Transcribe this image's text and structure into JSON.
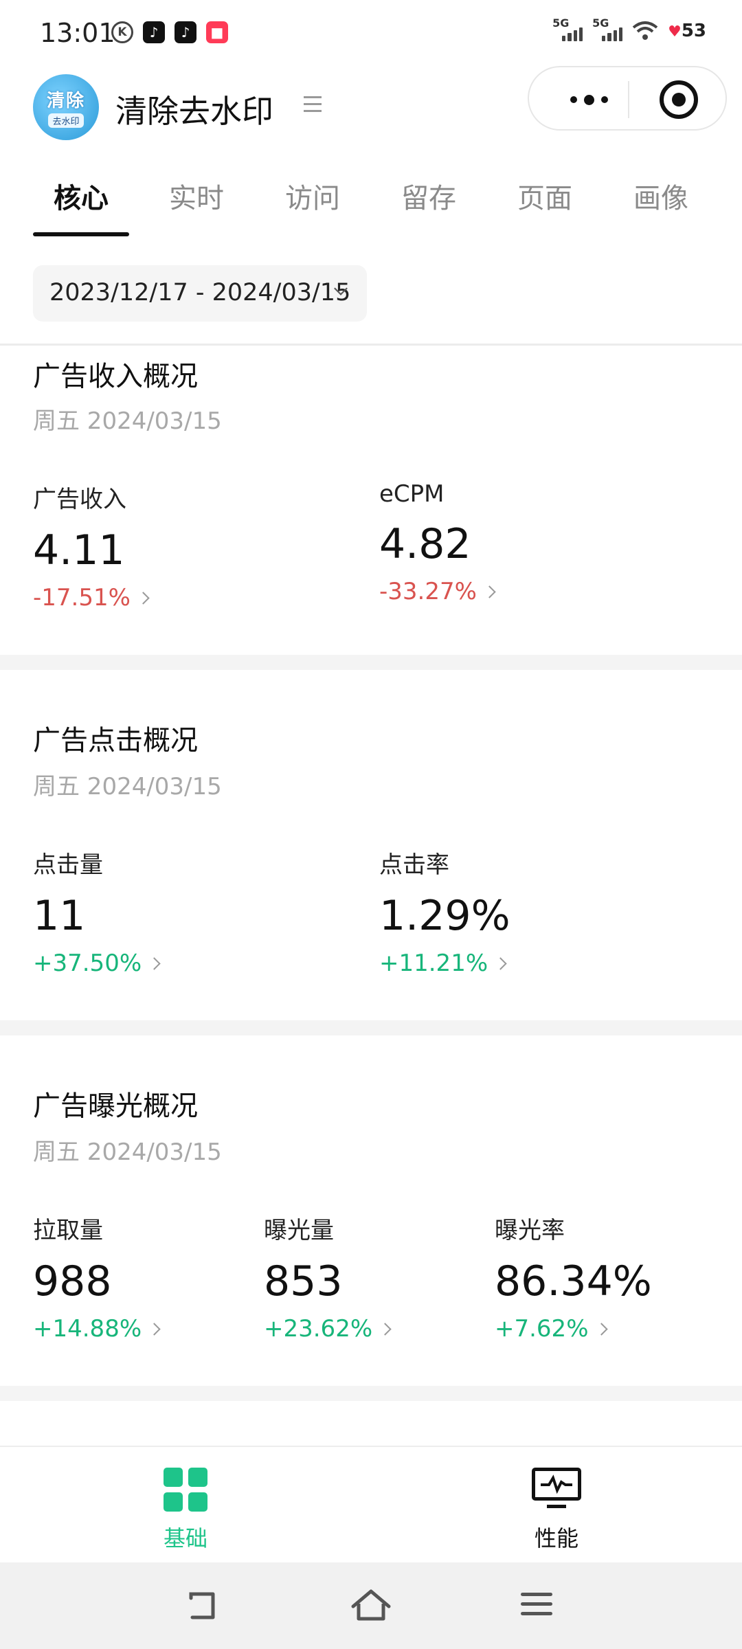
{
  "status_bar": {
    "time": "13:01",
    "k_icon": "K",
    "signal1": "5G",
    "signal2": "5G",
    "battery": "53"
  },
  "header": {
    "logo_line1": "清除",
    "logo_line2": "去水印",
    "title": "清除去水印"
  },
  "tabs": [
    {
      "label": "核心",
      "active": true
    },
    {
      "label": "实时",
      "active": false
    },
    {
      "label": "访问",
      "active": false
    },
    {
      "label": "留存",
      "active": false
    },
    {
      "label": "页面",
      "active": false
    },
    {
      "label": "画像",
      "active": false
    }
  ],
  "date_range": "2023/12/17 - 2024/03/15",
  "sections": {
    "revenue": {
      "title": "广告收入概况",
      "date": "周五 2024/03/15",
      "metrics": [
        {
          "label": "广告收入",
          "value": "4.11",
          "change": "-17.51%",
          "trend": "down"
        },
        {
          "label": "eCPM",
          "value": "4.82",
          "change": "-33.27%",
          "trend": "down"
        }
      ]
    },
    "clicks": {
      "title": "广告点击概况",
      "date": "周五 2024/03/15",
      "metrics": [
        {
          "label": "点击量",
          "value": "11",
          "change": "+37.50%",
          "trend": "up"
        },
        {
          "label": "点击率",
          "value": "1.29%",
          "change": "+11.21%",
          "trend": "up"
        }
      ]
    },
    "exposure": {
      "title": "广告曝光概况",
      "date": "周五 2024/03/15",
      "metrics": [
        {
          "label": "拉取量",
          "value": "988",
          "change": "+14.88%",
          "trend": "up"
        },
        {
          "label": "曝光量",
          "value": "853",
          "change": "+23.62%",
          "trend": "up"
        },
        {
          "label": "曝光率",
          "value": "86.34%",
          "change": "+7.62%",
          "trend": "up"
        }
      ]
    }
  },
  "bottom_nav": [
    {
      "label": "基础",
      "icon": "grid-icon",
      "active": true
    },
    {
      "label": "性能",
      "icon": "monitor-icon",
      "active": false
    }
  ],
  "colors": {
    "accent": "#1ec48a",
    "up": "#17b57a",
    "down": "#d9534f"
  }
}
